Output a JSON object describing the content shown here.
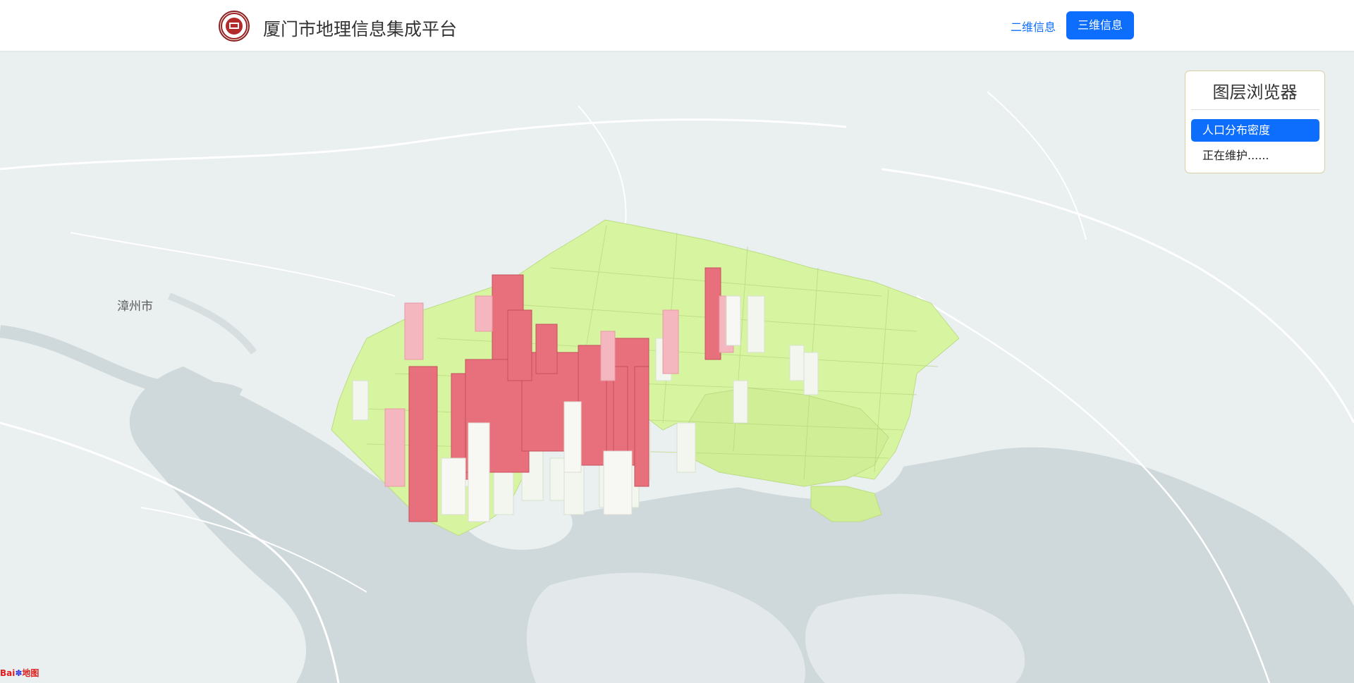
{
  "header": {
    "title": "厦门市地理信息集成平台",
    "nav_2d": "二维信息",
    "nav_3d": "三维信息",
    "logo_icon": "university-emblem-icon"
  },
  "map": {
    "place_label": "漳州市",
    "baidu_logo_text_1": "Bai",
    "baidu_logo_text_2": "地图"
  },
  "layer_panel": {
    "title": "图层浏览器",
    "items": [
      {
        "label": "人口分布密度",
        "active": true
      },
      {
        "label": "正在维护......",
        "active": false
      }
    ]
  },
  "colors": {
    "accent": "#0d6efd",
    "low_density": "#d7f5a0",
    "high_density": "#e8707c",
    "water": "#cfd8da",
    "land": "#eaeff0"
  }
}
